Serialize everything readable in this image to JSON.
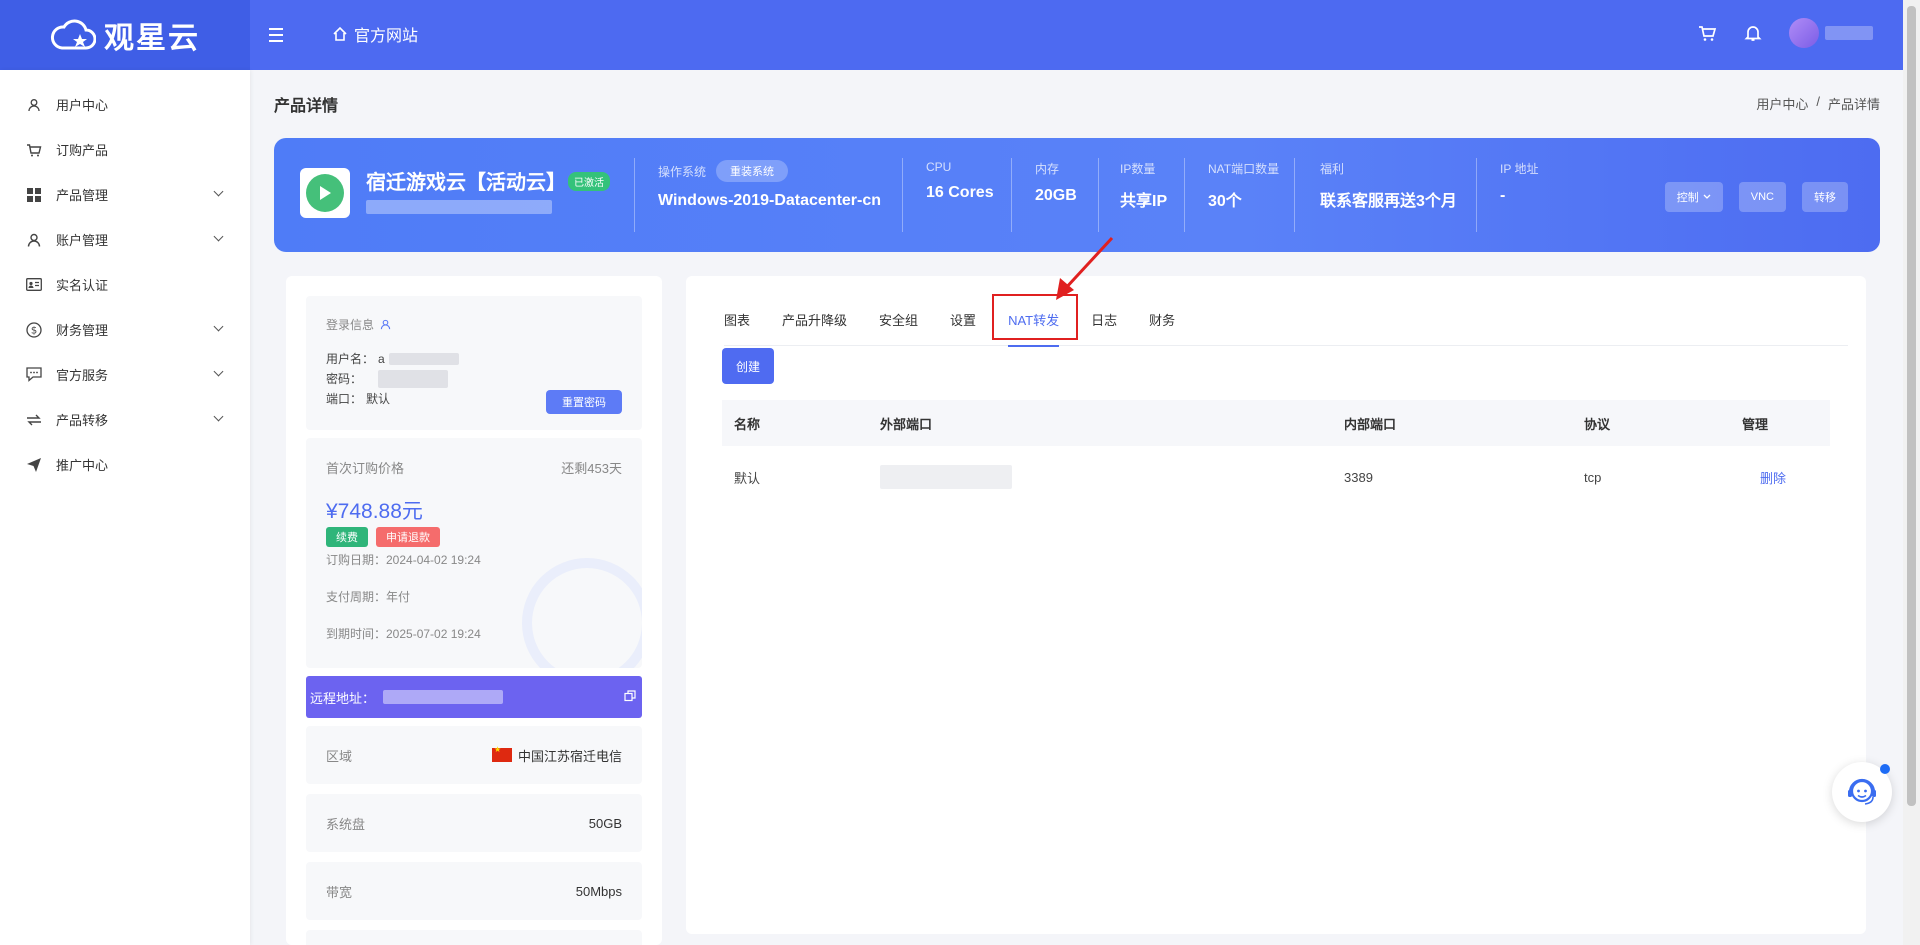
{
  "header": {
    "logo_text": "观星云",
    "home_link": "官方网站"
  },
  "sidebar": {
    "items": [
      {
        "label": "用户中心",
        "icon": "user-icon",
        "expandable": false
      },
      {
        "label": "订购产品",
        "icon": "cart-icon",
        "expandable": false
      },
      {
        "label": "产品管理",
        "icon": "grid-icon",
        "expandable": true
      },
      {
        "label": "账户管理",
        "icon": "person-icon",
        "expandable": true
      },
      {
        "label": "实名认证",
        "icon": "id-card-icon",
        "expandable": false
      },
      {
        "label": "财务管理",
        "icon": "dollar-icon",
        "expandable": true
      },
      {
        "label": "官方服务",
        "icon": "chat-icon",
        "expandable": true
      },
      {
        "label": "产品转移",
        "icon": "transfer-icon",
        "expandable": true
      },
      {
        "label": "推广中心",
        "icon": "send-icon",
        "expandable": false
      }
    ]
  },
  "page": {
    "title": "产品详情",
    "breadcrumb": [
      "用户中心",
      "/",
      "产品详情"
    ]
  },
  "product": {
    "name": "宿迁游戏云【活动云】",
    "status": "已激活",
    "specs": {
      "os_label": "操作系统",
      "reinstall_label": "重装系统",
      "os_value": "Windows-2019-Datacenter-cn",
      "cpu_label": "CPU",
      "cpu_value": "16 Cores",
      "mem_label": "内存",
      "mem_value": "20GB",
      "ip_count_label": "IP数量",
      "ip_count_value": "共享IP",
      "nat_label": "NAT端口数量",
      "nat_value": "30个",
      "bonus_label": "福利",
      "bonus_value": "联系客服再送3个月",
      "ip_addr_label": "IP 地址",
      "ip_addr_value": "-"
    },
    "buttons": {
      "control": "控制",
      "vnc": "VNC",
      "transfer": "转移"
    }
  },
  "login_info": {
    "title": "登录信息",
    "username_label": "用户名：",
    "username_prefix": "a",
    "password_label": "密码：",
    "port_label": "端口：",
    "port_value": "默认",
    "reset_password": "重置密码"
  },
  "pricing": {
    "first_price_label": "首次订购价格",
    "remaining": "还剩453天",
    "price": "¥748.88元",
    "renew_tag": "续费",
    "refund_tag": "申请退款",
    "order_date": "订购日期：2024-04-02 19:24",
    "pay_cycle": "支付周期：年付",
    "expire_date": "到期时间：2025-07-02 19:24"
  },
  "remote": {
    "label": "远程地址："
  },
  "details": [
    {
      "key": "区域",
      "value": "中国江苏宿迁电信",
      "flag": true
    },
    {
      "key": "系统盘",
      "value": "50GB",
      "flag": false
    },
    {
      "key": "带宽",
      "value": "50Mbps",
      "flag": false
    }
  ],
  "tabs": [
    "图表",
    "产品升降级",
    "安全组",
    "设置",
    "NAT转发",
    "日志",
    "财务"
  ],
  "active_tab": "NAT转发",
  "nat": {
    "create_button": "创建",
    "columns": [
      "名称",
      "外部端口",
      "内部端口",
      "协议",
      "管理"
    ],
    "rows": [
      {
        "name": "默认",
        "internal_port": "3389",
        "protocol": "tcp",
        "action": "删除"
      }
    ]
  },
  "colors": {
    "primary": "#4d6af1",
    "accent": "#4e6cf0",
    "success": "#2fb57a",
    "danger": "#f56c6c",
    "highlight": "#e02020"
  }
}
